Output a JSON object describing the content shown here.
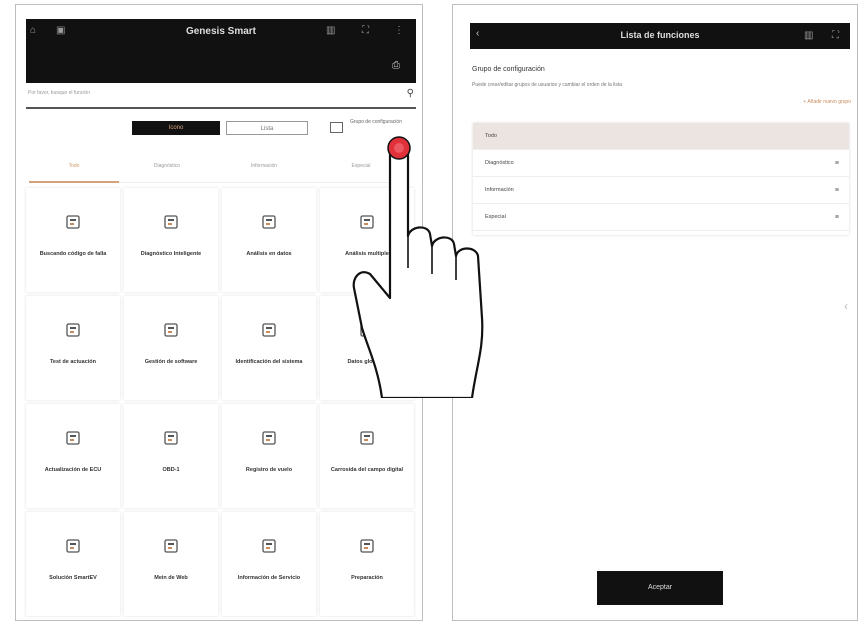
{
  "left": {
    "header": {
      "title": "Genesis Smart",
      "icons": [
        "home-icon",
        "car-vin-icon",
        "gallery-icon",
        "expand-icon",
        "more-icon",
        "printer-icon"
      ]
    },
    "search": {
      "placeholder": "Por favor, busque el función"
    },
    "view_toggle": {
      "active": "Icono",
      "inactive": "Lista"
    },
    "config_group": {
      "label": "Grupo de configuración"
    },
    "tabs": [
      {
        "label": "Todo",
        "active": true
      },
      {
        "label": "Diagnóstico",
        "active": false
      },
      {
        "label": "Información",
        "active": false
      },
      {
        "label": "Especial",
        "active": false
      }
    ],
    "grid": [
      {
        "label": "Buscando código de falla",
        "icon": "dtc-search-icon"
      },
      {
        "label": "Diagnóstico Inteligente",
        "icon": "smart-diagnosis-icon"
      },
      {
        "label": "Análisis en datos",
        "icon": "data-analysis-icon"
      },
      {
        "label": "Análisis multiple",
        "icon": "multi-analysis-icon"
      },
      {
        "label": "Test de actuación",
        "icon": "actuation-test-icon"
      },
      {
        "label": "Gestión de software",
        "icon": "software-icon"
      },
      {
        "label": "Identificación del sistema",
        "icon": "system-id-icon"
      },
      {
        "label": "Datos globales",
        "icon": "global-data-icon"
      },
      {
        "label": "Actualización de ECU",
        "icon": "ecu-update-icon"
      },
      {
        "label": "OBD-1",
        "icon": "obd-icon"
      },
      {
        "label": "Registro de vuelo",
        "icon": "flight-record-icon"
      },
      {
        "label": "Carrosida del campo digital",
        "icon": "digital-field-icon"
      },
      {
        "label": "Solución SmartEV",
        "icon": "smartev-icon"
      },
      {
        "label": "Mein de Web",
        "icon": "web-icon"
      },
      {
        "label": "Información de Servicio",
        "icon": "service-info-icon"
      },
      {
        "label": "Preparación",
        "icon": "preparation-icon"
      }
    ]
  },
  "right": {
    "header": {
      "title": "Lista de funciones",
      "back_icon": "back-arrow-icon"
    },
    "section_title": "Grupo de configuración",
    "description": "Puede crear/editar grupos de usuarios y cambiar el orden de la lista",
    "add_link": "+ Añadir nuevo grupo",
    "groups": [
      {
        "label": "Todo",
        "selected": true
      },
      {
        "label": "Diagnóstico",
        "selected": false
      },
      {
        "label": "Información",
        "selected": false
      },
      {
        "label": "Especial",
        "selected": false
      }
    ],
    "accept_button": "Aceptar"
  },
  "colors": {
    "accent": "#d4a27a",
    "header_bg": "#111111",
    "tap_marker": "#e0303a"
  }
}
